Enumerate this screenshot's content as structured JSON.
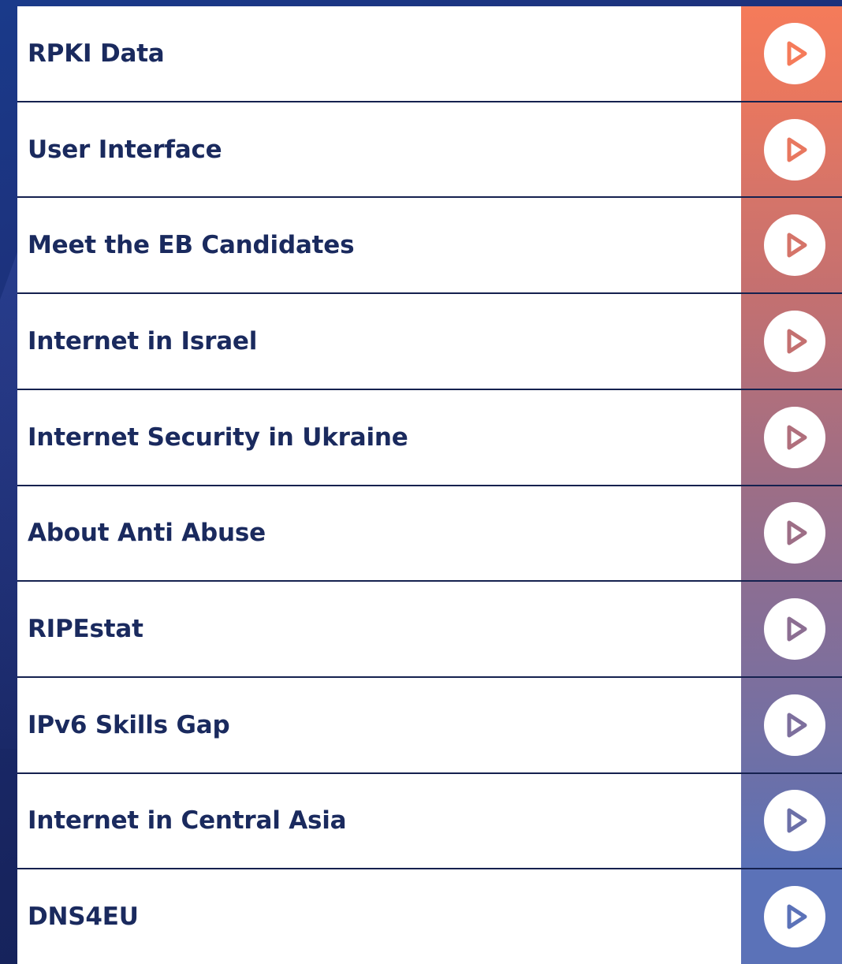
{
  "playlist": {
    "items": [
      {
        "label": "RPKI Data",
        "accent": "#f57b5a"
      },
      {
        "label": "User Interface",
        "accent": "#e8775f"
      },
      {
        "label": "Meet the EB Candidates",
        "accent": "#d57469"
      },
      {
        "label": "Internet in Israel",
        "accent": "#c47070"
      },
      {
        "label": "Internet Security in Ukraine",
        "accent": "#b06f7c"
      },
      {
        "label": "About Anti Abuse",
        "accent": "#9d6e86"
      },
      {
        "label": "RIPEstat",
        "accent": "#8c6e92"
      },
      {
        "label": "IPv6 Skills Gap",
        "accent": "#7d6f9d"
      },
      {
        "label": "Internet in Central Asia",
        "accent": "#6c70a8"
      },
      {
        "label": "DNS4EU",
        "accent": "#5b72b8"
      }
    ],
    "icon": "play-icon"
  }
}
